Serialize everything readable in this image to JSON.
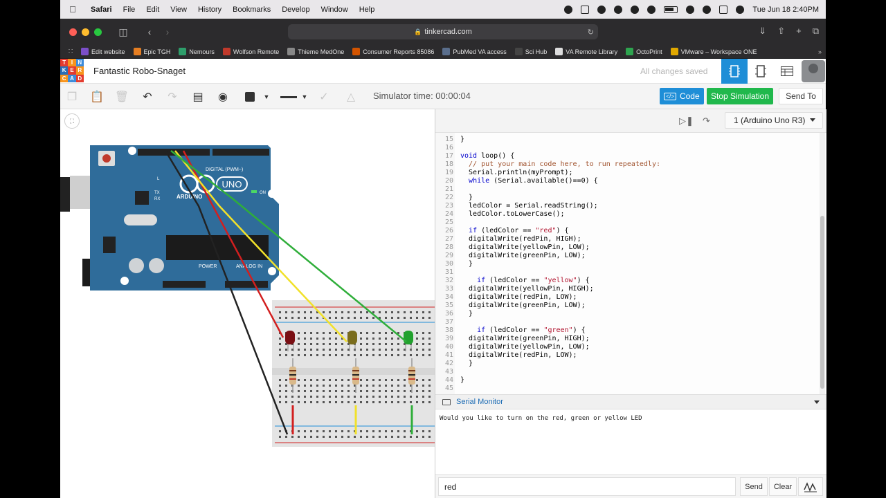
{
  "menubar": {
    "app": "Safari",
    "items": [
      "File",
      "Edit",
      "View",
      "History",
      "Bookmarks",
      "Develop",
      "Window",
      "Help"
    ],
    "datetime": "Tue Jun 18  2:40PM"
  },
  "browser": {
    "url": "tinkercad.com",
    "bookmarks": [
      {
        "label": "Edit website",
        "color": "#7b4fc9"
      },
      {
        "label": "Epic TGH",
        "color": "#e67e22"
      },
      {
        "label": "Nemours",
        "color": "#2e9e6b"
      },
      {
        "label": "Wolfson Remote",
        "color": "#c0392b"
      },
      {
        "label": "Thieme MedOne",
        "color": "#888888"
      },
      {
        "label": "Consumer Reports 85086",
        "color": "#d35400"
      },
      {
        "label": "PubMed VA access",
        "color": "#5a6e8c"
      },
      {
        "label": "Sci Hub",
        "color": "#444444"
      },
      {
        "label": "VA Remote Library",
        "color": "#dddddd"
      },
      {
        "label": "OctoPrint",
        "color": "#2ea44f"
      },
      {
        "label": "VMware – Workspace ONE",
        "color": "#e0a800"
      }
    ]
  },
  "app": {
    "logo_letters": [
      "T",
      "I",
      "N",
      "K",
      "E",
      "R",
      "C",
      "A",
      "D"
    ],
    "project_title": "Fantastic Robo-Snaget",
    "save_status": "All changes saved"
  },
  "toolbar": {
    "sim_time": "Simulator time: 00:00:04",
    "code_label": "Code",
    "stop_label": "Stop Simulation",
    "send_label": "Send To"
  },
  "code_panel": {
    "board": "1 (Arduino Uno R3)",
    "lines": [
      {
        "n": "15",
        "t": "}"
      },
      {
        "n": "16",
        "t": ""
      },
      {
        "n": "17",
        "t": "void loop() {"
      },
      {
        "n": "18",
        "t": "  // put your main code here, to run repeatedly:"
      },
      {
        "n": "19",
        "t": "  Serial.println(myPrompt);"
      },
      {
        "n": "20",
        "t": "  while (Serial.available()==0) {"
      },
      {
        "n": "21",
        "t": ""
      },
      {
        "n": "22",
        "t": "  }"
      },
      {
        "n": "23",
        "t": "  ledColor = Serial.readString();"
      },
      {
        "n": "24",
        "t": "  ledColor.toLowerCase();"
      },
      {
        "n": "25",
        "t": ""
      },
      {
        "n": "26",
        "t": "  if (ledColor == \"red\") {"
      },
      {
        "n": "27",
        "t": "  digitalWrite(redPin, HIGH);"
      },
      {
        "n": "28",
        "t": "  digitalWrite(yellowPin, LOW);"
      },
      {
        "n": "29",
        "t": "  digitalWrite(greenPin, LOW);"
      },
      {
        "n": "30",
        "t": "  }"
      },
      {
        "n": "31",
        "t": ""
      },
      {
        "n": "32",
        "t": "    if (ledColor == \"yellow\") {"
      },
      {
        "n": "33",
        "t": "  digitalWrite(yellowPin, HIGH);"
      },
      {
        "n": "34",
        "t": "  digitalWrite(redPin, LOW);"
      },
      {
        "n": "35",
        "t": "  digitalWrite(greenPin, LOW);"
      },
      {
        "n": "36",
        "t": "  }"
      },
      {
        "n": "37",
        "t": ""
      },
      {
        "n": "38",
        "t": "    if (ledColor == \"green\") {"
      },
      {
        "n": "39",
        "t": "  digitalWrite(greenPin, HIGH);"
      },
      {
        "n": "40",
        "t": "  digitalWrite(yellowPin, LOW);"
      },
      {
        "n": "41",
        "t": "  digitalWrite(redPin, LOW);"
      },
      {
        "n": "42",
        "t": "  }"
      },
      {
        "n": "43",
        "t": ""
      },
      {
        "n": "44",
        "t": "}"
      },
      {
        "n": "45",
        "t": ""
      }
    ]
  },
  "serial": {
    "title": "Serial Monitor",
    "output": "Would you like to turn on the red, green or yellow LED",
    "input_value": "red",
    "send_label": "Send",
    "clear_label": "Clear"
  },
  "board_labels": {
    "brand": "UNO",
    "maker": "ARDUINO",
    "digital": "DIGITAL (PWM~)",
    "power": "POWER",
    "analog": "ANALOG IN",
    "on": "ON",
    "tx": "TX",
    "rx": "RX",
    "l": "L"
  },
  "colors": {
    "accent_blue": "#1e8ed7",
    "stop_green": "#20b84c",
    "wire_red": "#d21f1f",
    "wire_yellow": "#f1e12a",
    "wire_green": "#2fae3a",
    "wire_black": "#222222",
    "board_blue": "#2f6c9a"
  }
}
